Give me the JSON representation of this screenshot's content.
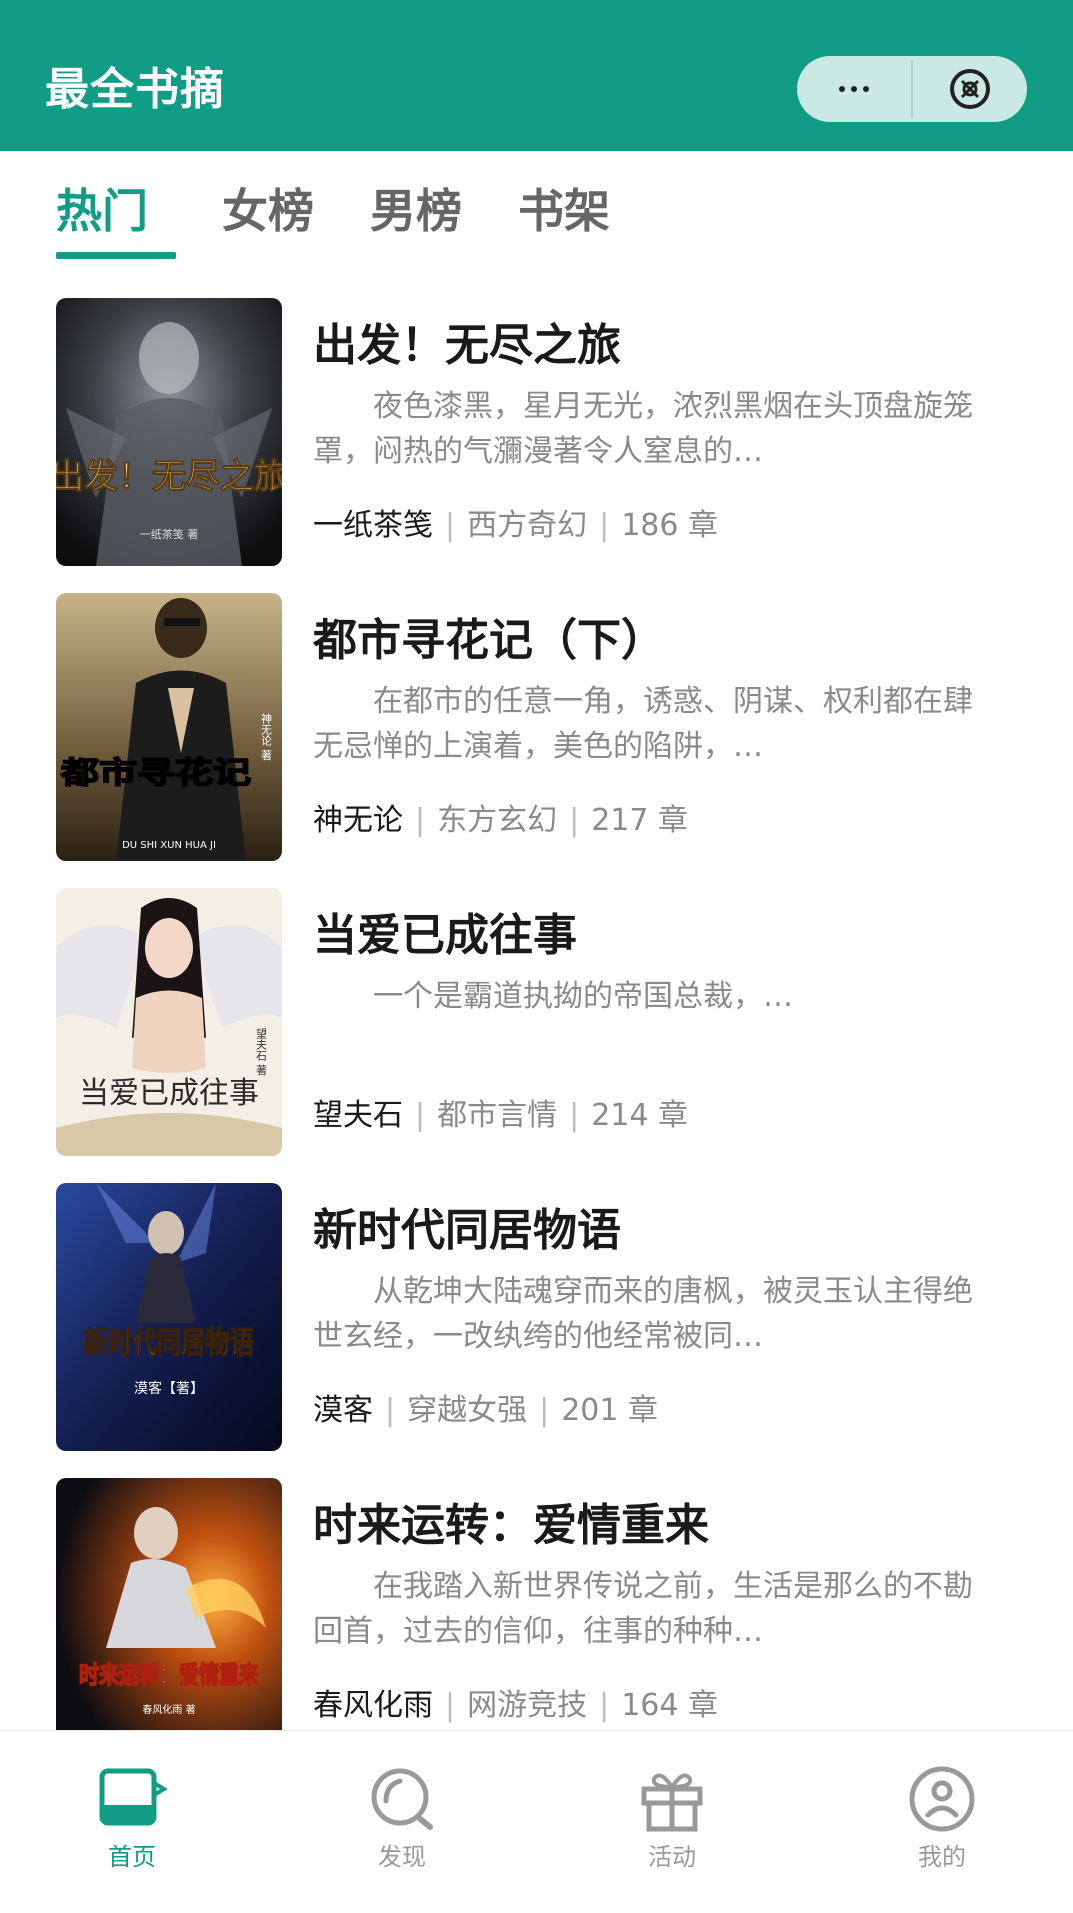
{
  "header": {
    "title": "最全书摘"
  },
  "tabs": [
    {
      "label": "热门",
      "active": true
    },
    {
      "label": "女榜",
      "active": false
    },
    {
      "label": "男榜",
      "active": false
    },
    {
      "label": "书架",
      "active": false
    }
  ],
  "books": [
    {
      "title": "出发！无尽之旅",
      "desc": "夜色漆黑，星月无光，浓烈黑烟在头顶盘旋笼罩，闷热的气瀰漫著令人窒息的…",
      "author": "一纸茶笺",
      "category": "西方奇幻",
      "chapters": "186 章",
      "cover_text": "出发！无尽之旅",
      "cover_author": "一纸茶笺 著"
    },
    {
      "title": "都市寻花记（下）",
      "desc": "在都市的任意一角，诱惑、阴谋、权利都在肆无忌惮的上演着，美色的陷阱，…",
      "author": "神无论",
      "category": "东方玄幻",
      "chapters": "217 章",
      "cover_text": "都市寻花记",
      "cover_author": "神无论 著",
      "cover_sub": "DU SHI XUN HUA JI"
    },
    {
      "title": "当爱已成往事",
      "desc": "一个是霸道执拗的帝国总裁，…",
      "author": "望夫石",
      "category": "都市言情",
      "chapters": "214 章",
      "cover_text": "当爱已成往事",
      "cover_author": "望夫石 著"
    },
    {
      "title": "新时代同居物语",
      "desc": "从乾坤大陆魂穿而来的唐枫，被灵玉认主得绝世玄经，一改纨绔的他经常被同…",
      "author": "漠客",
      "category": "穿越女强",
      "chapters": "201 章",
      "cover_text": "新时代同居物语",
      "cover_author": "漠客【著】"
    },
    {
      "title": "时来运转：爱情重来",
      "desc": "在我踏入新世界传说之前，生活是那么的不勘回首，过去的信仰，往事的种种…",
      "author": "春风化雨",
      "category": "网游竞技",
      "chapters": "164 章",
      "cover_text": "时来运转：爱情重来",
      "cover_author": "春风化雨 著"
    }
  ],
  "nav": [
    {
      "label": "首页",
      "icon": "book-icon",
      "active": true
    },
    {
      "label": "发现",
      "icon": "discover-icon",
      "active": false
    },
    {
      "label": "活动",
      "icon": "gift-icon",
      "active": false
    },
    {
      "label": "我的",
      "icon": "profile-icon",
      "active": false
    }
  ],
  "colors": {
    "primary": "#109c85",
    "text_dark": "#1a1a1a",
    "text_muted": "#8a8a8a"
  }
}
